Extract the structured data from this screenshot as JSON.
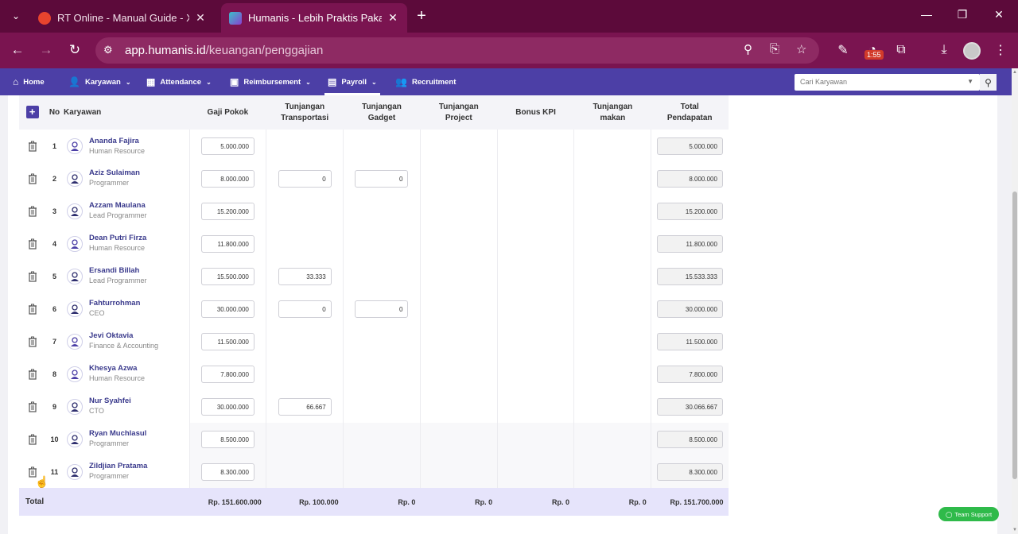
{
  "browser": {
    "tabs": [
      {
        "title": "RT Online - Manual Guide - Xmi"
      },
      {
        "title": "Humanis - Lebih Praktis Pakai H"
      }
    ],
    "url": {
      "host": "app.humanis.id",
      "path": "/keuangan/penggajian"
    },
    "badge": "1:55"
  },
  "nav": {
    "items": [
      {
        "label": "Home",
        "icon": "home-icon"
      },
      {
        "label": "Karyawan",
        "icon": "user-edit-icon"
      },
      {
        "label": "Attendance",
        "icon": "calendar-icon"
      },
      {
        "label": "Reimbursement",
        "icon": "money-icon"
      },
      {
        "label": "Payroll",
        "icon": "payroll-icon"
      },
      {
        "label": "Recruitment",
        "icon": "users-icon"
      }
    ],
    "search_placeholder": "Cari Karyawan"
  },
  "table": {
    "headers": {
      "add": "+",
      "no": "No",
      "karyawan": "Karyawan",
      "gaji_pokok": "Gaji Pokok",
      "tunjangan_transportasi_1": "Tunjangan",
      "tunjangan_transportasi_2": "Transportasi",
      "tunjangan_gadget_1": "Tunjangan",
      "tunjangan_gadget_2": "Gadget",
      "tunjangan_project_1": "Tunjangan",
      "tunjangan_project_2": "Project",
      "bonus_kpi": "Bonus KPI",
      "tunjangan_makan_1": "Tunjangan",
      "tunjangan_makan_2": "makan",
      "total_pendapatan_1": "Total",
      "total_pendapatan_2": "Pendapatan"
    },
    "rows": [
      {
        "no": "1",
        "name": "Ananda Fajira",
        "dept": "Human Resource",
        "gaji": "5.000.000",
        "transport": "",
        "gadget": "",
        "total": "5.000.000",
        "avatar": "female"
      },
      {
        "no": "2",
        "name": "Aziz Sulaiman",
        "dept": "Programmer",
        "gaji": "8.000.000",
        "transport": "0",
        "gadget": "0",
        "total": "8.000.000",
        "avatar": "male"
      },
      {
        "no": "3",
        "name": "Azzam Maulana",
        "dept": "Lead Programmer",
        "gaji": "15.200.000",
        "transport": "",
        "gadget": "",
        "total": "15.200.000",
        "avatar": "male"
      },
      {
        "no": "4",
        "name": "Dean Putri Firza",
        "dept": "Human Resource",
        "gaji": "11.800.000",
        "transport": "",
        "gadget": "",
        "total": "11.800.000",
        "avatar": "female"
      },
      {
        "no": "5",
        "name": "Ersandi Billah",
        "dept": "Lead Programmer",
        "gaji": "15.500.000",
        "transport": "33.333",
        "gadget": "",
        "total": "15.533.333",
        "avatar": "male"
      },
      {
        "no": "6",
        "name": "Fahturrohman",
        "dept": "CEO",
        "gaji": "30.000.000",
        "transport": "0",
        "gadget": "0",
        "total": "30.000.000",
        "avatar": "male"
      },
      {
        "no": "7",
        "name": "Jevi Oktavia",
        "dept": "Finance & Accounting",
        "gaji": "11.500.000",
        "transport": "",
        "gadget": "",
        "total": "11.500.000",
        "avatar": "female"
      },
      {
        "no": "8",
        "name": "Khesya Azwa",
        "dept": "Human Resource",
        "gaji": "7.800.000",
        "transport": "",
        "gadget": "",
        "total": "7.800.000",
        "avatar": "female"
      },
      {
        "no": "9",
        "name": "Nur Syahfei",
        "dept": "CTO",
        "gaji": "30.000.000",
        "transport": "66.667",
        "gadget": "",
        "total": "30.066.667",
        "avatar": "male"
      },
      {
        "no": "10",
        "name": "Ryan Muchlasul",
        "dept": "Programmer",
        "gaji": "8.500.000",
        "transport": "",
        "gadget": "",
        "total": "8.500.000",
        "avatar": "male"
      },
      {
        "no": "11",
        "name": "Zildjian Pratama",
        "dept": "Programmer",
        "gaji": "8.300.000",
        "transport": "",
        "gadget": "",
        "total": "8.300.000",
        "avatar": "male"
      }
    ],
    "totals": {
      "label": "Total",
      "gaji_pokok": "Rp. 151.600.000",
      "transportasi": "Rp. 100.000",
      "gadget": "Rp. 0",
      "project": "Rp. 0",
      "bonus_kpi": "Rp. 0",
      "makan": "Rp. 0",
      "total_pendapatan": "Rp. 151.700.000"
    }
  },
  "support_button": "Team Support",
  "colors": {
    "nav": "#4c3fa6",
    "name": "#3a3a8c",
    "support": "#2fba4a",
    "browser": "#7a1450"
  }
}
